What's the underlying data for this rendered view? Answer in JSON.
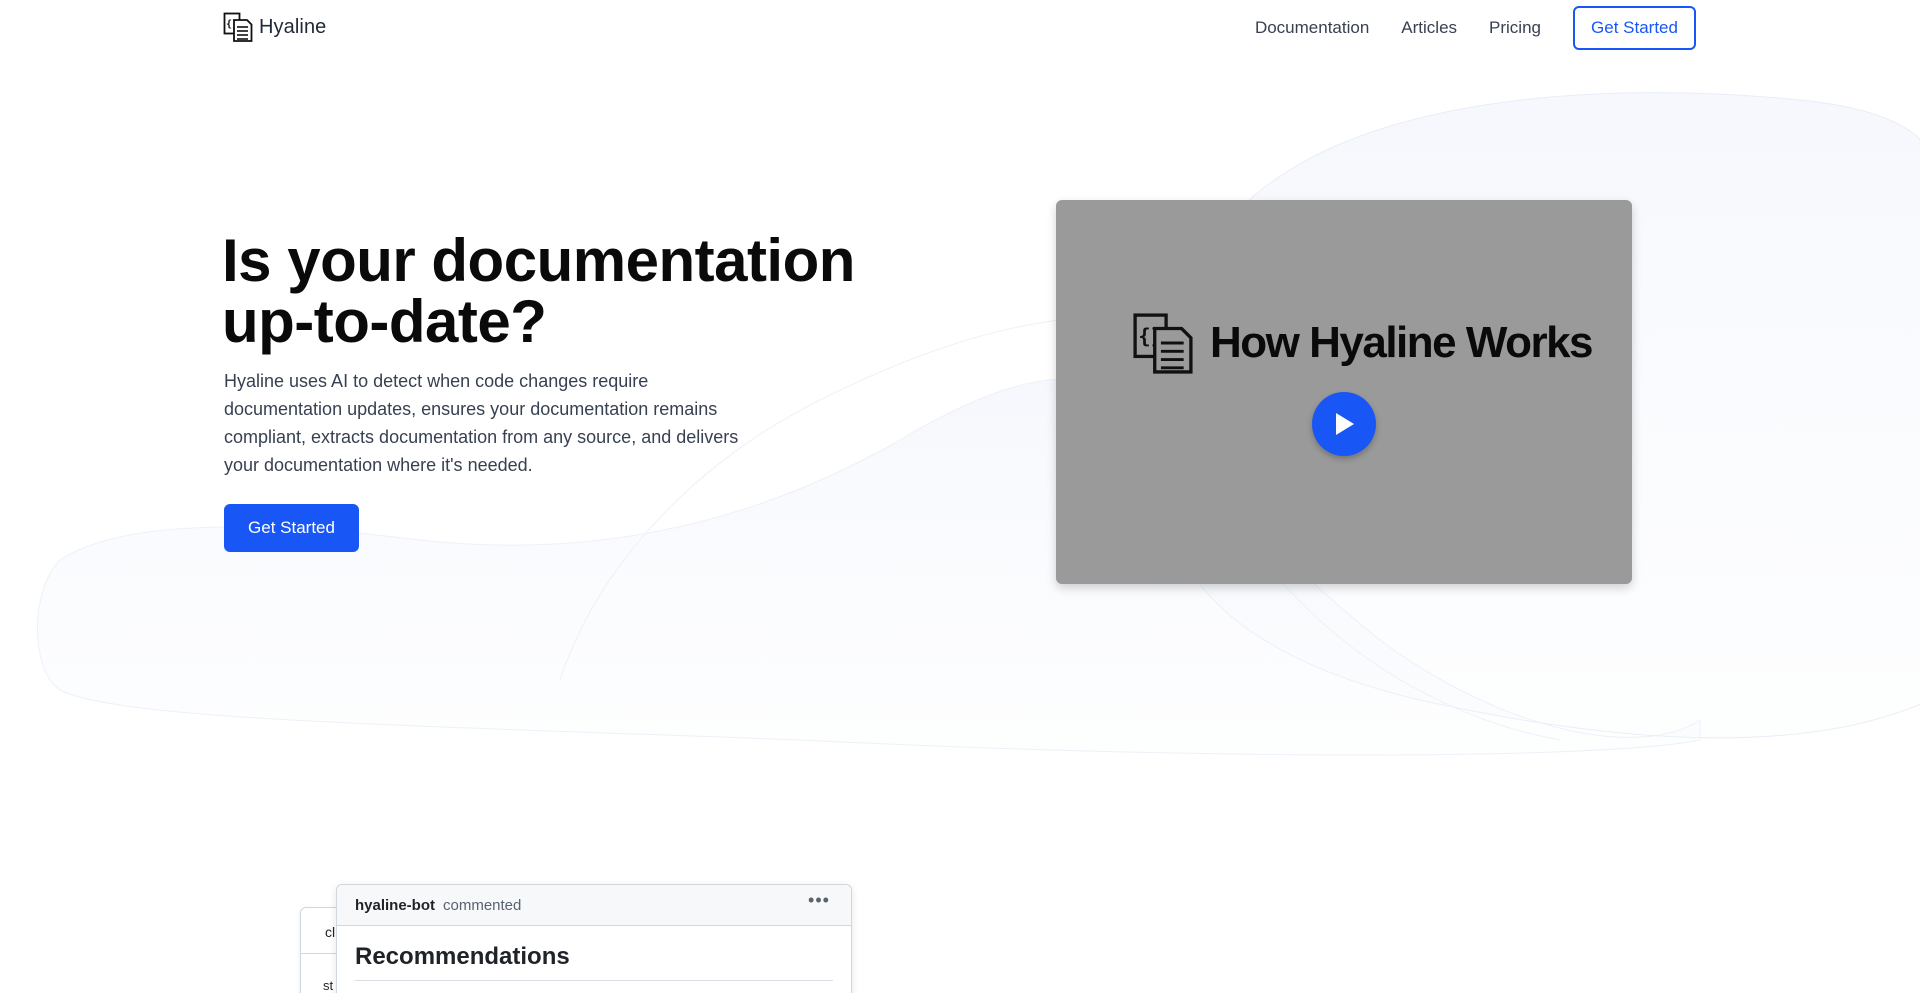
{
  "brand": {
    "name": "Hyaline",
    "logo_icon": "code-document-icon",
    "accent_color": "#1857f5"
  },
  "nav": {
    "links": [
      "Documentation",
      "Articles",
      "Pricing"
    ],
    "cta_label": "Get Started"
  },
  "hero": {
    "title": "Is your documentation up-to-date?",
    "description": "Hyaline uses AI to detect when code changes require documentation updates, ensures your documentation remains compliant, extracts documentation from any source, and delivers your documentation where it's needed.",
    "cta_label": "Get Started"
  },
  "video": {
    "title": "How Hyaline Works",
    "play_icon": "play-icon",
    "background_color": "#9a9a9a"
  },
  "comment_card": {
    "author": "hyaline-bot",
    "action": "commented",
    "menu_icon": "kebab-menu-icon",
    "heading": "Recommendations"
  },
  "back_card": {
    "line1": "cl",
    "line2": "st"
  }
}
